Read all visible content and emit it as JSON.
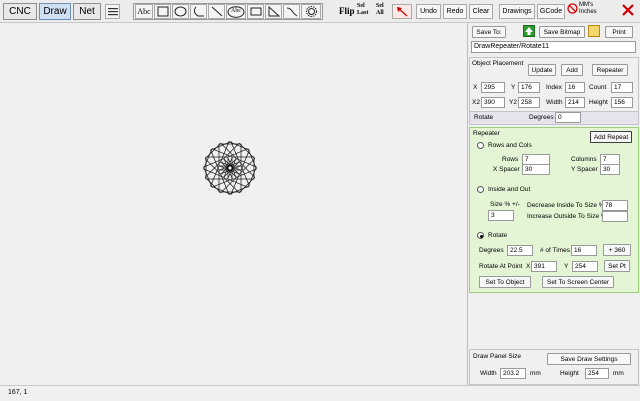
{
  "tabs": [
    "CNC",
    "Draw",
    "Net"
  ],
  "toolbar": {
    "abc_label": "Abc",
    "abc_circle_label": "Abc",
    "flip_label": "Flip",
    "sel_last_label": "Sel Last",
    "sel_all_label": "Sel All",
    "undo_label": "Undo",
    "redo_label": "Redo",
    "clear_label": "Clear",
    "drawings_label": "Drawings",
    "gcode_label": "GCode",
    "units_mm": "MM's",
    "units_in": "Inches",
    "tool_icons": [
      "menu-icon",
      "abc-text-icon",
      "square-icon",
      "ellipse-icon",
      "arc-icon",
      "line-icon",
      "abc-circle-text-icon",
      "rectangle-icon",
      "triangle-icon",
      "curve-icon",
      "gear-icon",
      "flip-icon",
      "select-last-icon",
      "select-all-icon",
      "pointer-arrow-icon",
      "no-units-icon",
      "close-icon"
    ]
  },
  "status": {
    "coords": "167, 1"
  },
  "panel": {
    "save_to_label": "Save To:",
    "save_bitmap_label": "Save Bitmap",
    "print_label": "Print",
    "drawing_name": "DrawRepeater/Rotate11",
    "placement": {
      "title": "Object Placement",
      "update_label": "Update",
      "add_label": "Add",
      "repeater_label": "Repeater",
      "x_label": "X",
      "x_value": "295",
      "y_label": "Y",
      "y_value": "176",
      "index_label": "Index",
      "index_value": "16",
      "count_label": "Count",
      "count_value": "17",
      "x2_label": "X2",
      "x2_value": "390",
      "y2_label": "Y2",
      "y2_value": "258",
      "width_label": "Width",
      "width_value": "214",
      "height_label": "Height",
      "height_value": "156"
    },
    "rotate": {
      "label": "Rotate",
      "degrees_label": "Degrees",
      "degrees_value": "0"
    },
    "repeater": {
      "title": "Repeater",
      "add_repeat_label": "Add Repeat",
      "rows_cols_label": "Rows and Cols",
      "rows_label": "Rows",
      "rows_value": "7",
      "columns_label": "Columns",
      "columns_value": "7",
      "x_spacer_label": "X Spacer",
      "x_spacer_value": "30",
      "y_spacer_label": "Y Spacer",
      "y_spacer_value": "30",
      "inside_out_label": "Inside and Out",
      "size_pct_label": "Size % +/-",
      "size_pct_value": "3",
      "decrease_label": "Decrease Inside To Size %",
      "decrease_value": "78",
      "increase_label": "Increase Outside To Size %",
      "increase_value": "",
      "rotate_label": "Rotate",
      "degrees_label": "Degrees",
      "degrees_value": "22.5",
      "times_label": "# of Times",
      "times_value": "16",
      "plus360_label": "+ 360",
      "rotate_point_label": "Rotate At Point",
      "rp_x_label": "X",
      "rp_x_value": "391",
      "rp_y_label": "Y",
      "rp_y_value": "254",
      "set_pt_label": "Set Pt",
      "set_object_label": "Set To Object",
      "set_center_label": "Set To Screen Center"
    },
    "draw_panel": {
      "title": "Draw Panel Size",
      "save_settings_label": "Save Draw Settings",
      "width_label": "Width",
      "width_value": "203.2",
      "width_unit": "mm",
      "height_label": "Height",
      "height_value": "254",
      "height_unit": "mm"
    }
  },
  "colors": {
    "accent_active_tab": "#cfe0f2",
    "repeater_bg": "#e4f5d6",
    "close_red": "#d00000",
    "save_arrow_green": "#2e9b2e"
  }
}
